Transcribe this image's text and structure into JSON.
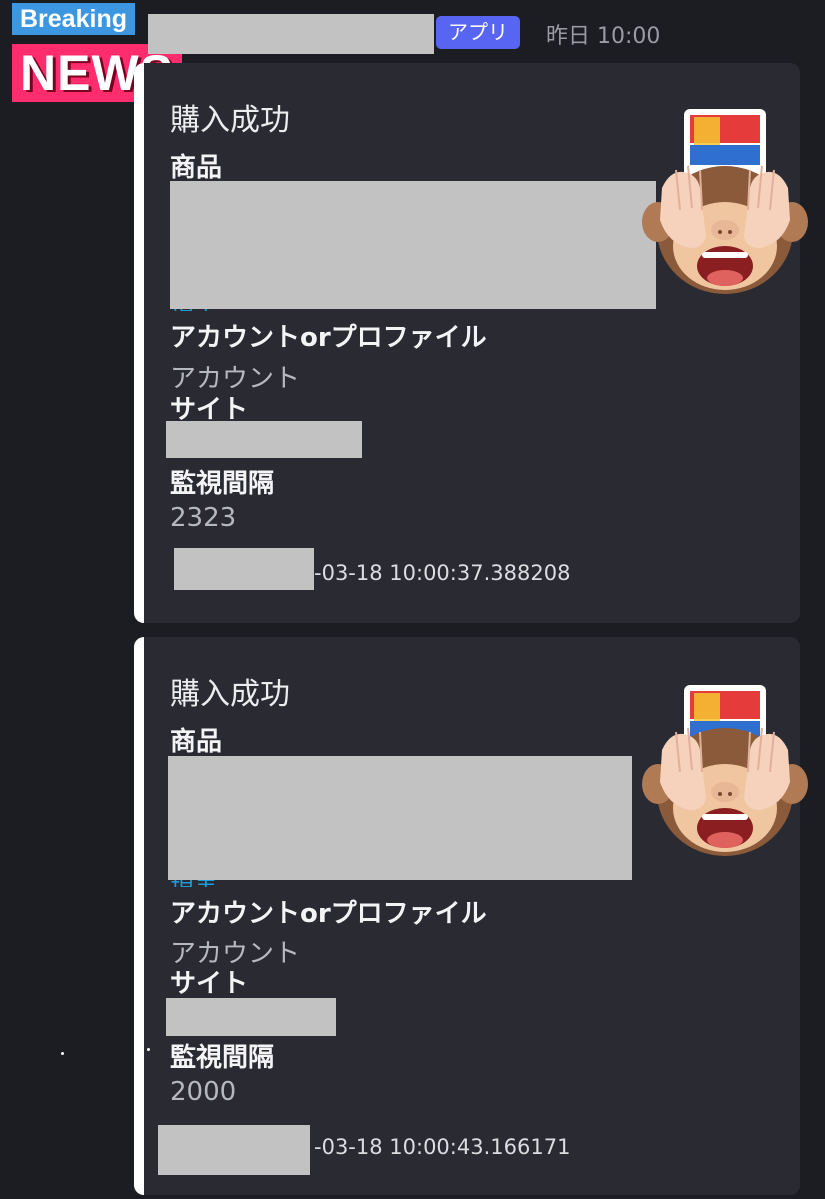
{
  "overlay": {
    "breaking_label": "Breaking",
    "news_label": "NEWS"
  },
  "header": {
    "app_badge": "アプリ",
    "timestamp": "昨日 10:00"
  },
  "messages": [
    {
      "title": "購入成功",
      "product_label": "商品",
      "link_fragment": "現実",
      "account_label": "アカウントorプロファイル",
      "account_value": "アカウント",
      "site_label": "サイト",
      "interval_label": "監視間隔",
      "interval_value": "2323",
      "footer_time": "-03-18 10:00:37.388208"
    },
    {
      "title": "購入成功",
      "product_label": "商品",
      "link_fragment": "現実",
      "account_label": "アカウントorプロファイル",
      "account_value": "アカウント",
      "site_label": "サイト",
      "interval_label": "監視間隔",
      "interval_value": "2000",
      "footer_time": "-03-18 10:00:43.166171"
    }
  ],
  "colors": {
    "background": "#1c1d22",
    "card": "#2a2b32",
    "accent": "#5865f2",
    "link": "#1f9bd8",
    "redaction": "#c2c2c2"
  },
  "icons": [
    "see-no-evil-monkey-icon",
    "product-thumbnail"
  ]
}
